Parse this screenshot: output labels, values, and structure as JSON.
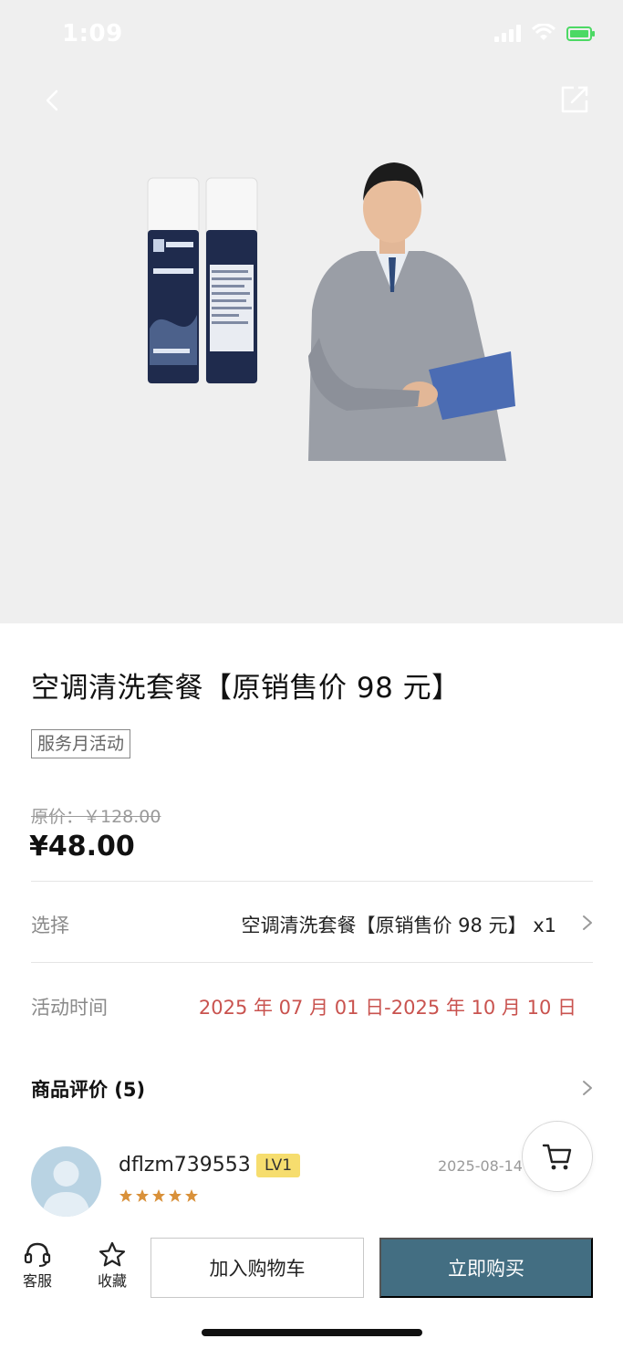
{
  "status_bar": {
    "time": "1:09"
  },
  "product": {
    "title": "空调清洗套餐【原销售价 98 元】",
    "tag": "服务月活动",
    "original_price": "原价：￥128.00",
    "price": "¥48.00"
  },
  "options": {
    "select_label": "选择",
    "select_value": "空调清洗套餐【原销售价 98 元】 x1",
    "activity_label": "活动时间",
    "activity_value": "2025 年 07 月 01 日-2025 年 10 月 10 日"
  },
  "reviews": {
    "title": "商品评价 (5)",
    "items": [
      {
        "user": "dflzm739553",
        "level": "LV1",
        "date": "2025-08-14",
        "rating": 5
      }
    ]
  },
  "bottom_bar": {
    "service_label": "客服",
    "favorite_label": "收藏",
    "add_cart_label": "加入购物车",
    "buy_now_label": "立即购买"
  },
  "colors": {
    "accent": "#436e82",
    "activity_red": "#c9534f",
    "star": "#d9913a",
    "badge_yellow": "#f6dd6e"
  },
  "icons": [
    "back-icon",
    "share-icon",
    "cart-icon",
    "headset-icon",
    "star-icon",
    "chevron-right-icon",
    "signal-icon",
    "wifi-icon",
    "battery-icon"
  ]
}
